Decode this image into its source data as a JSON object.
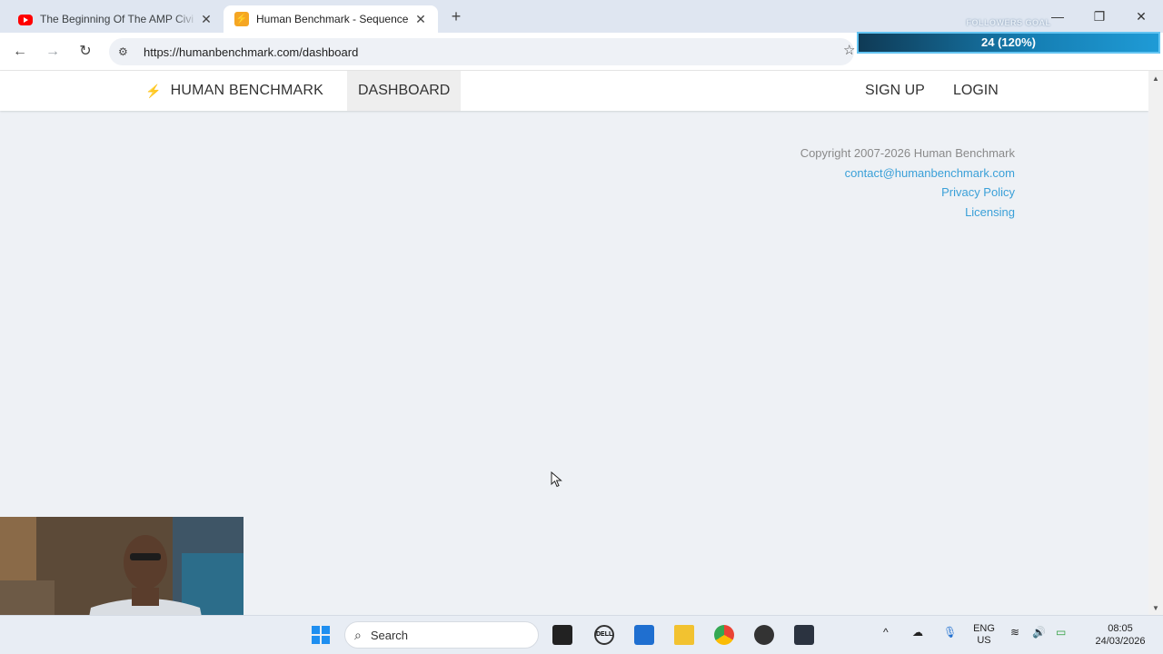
{
  "browser": {
    "tabs": [
      {
        "title": "The Beginning Of The AMP Civi",
        "icon": "youtube-icon",
        "active": false
      },
      {
        "title": "Human Benchmark - Sequence",
        "icon": "human-benchmark-icon",
        "active": true
      }
    ],
    "url": "https://humanbenchmark.com/dashboard"
  },
  "overlay": {
    "label": "FOLLOWERS GOAL",
    "value": "24 (120%)"
  },
  "site": {
    "brand": "HUMAN BENCHMARK",
    "nav": {
      "dashboard": "DASHBOARD",
      "signup": "SIGN UP",
      "login": "LOGIN"
    },
    "footer": {
      "copyright": "Copyright 2007-2026 Human Benchmark",
      "email": "contact@humanbenchmark.com",
      "privacy": "Privacy Policy",
      "licensing": "Licensing"
    }
  },
  "taskbar": {
    "search_placeholder": "Search",
    "language": "ENG",
    "region": "US",
    "time": "08:05",
    "date": "24/03/2026"
  },
  "colors": {
    "accent_link": "#3aa0d8",
    "overlay_bar": "#1680b5"
  }
}
